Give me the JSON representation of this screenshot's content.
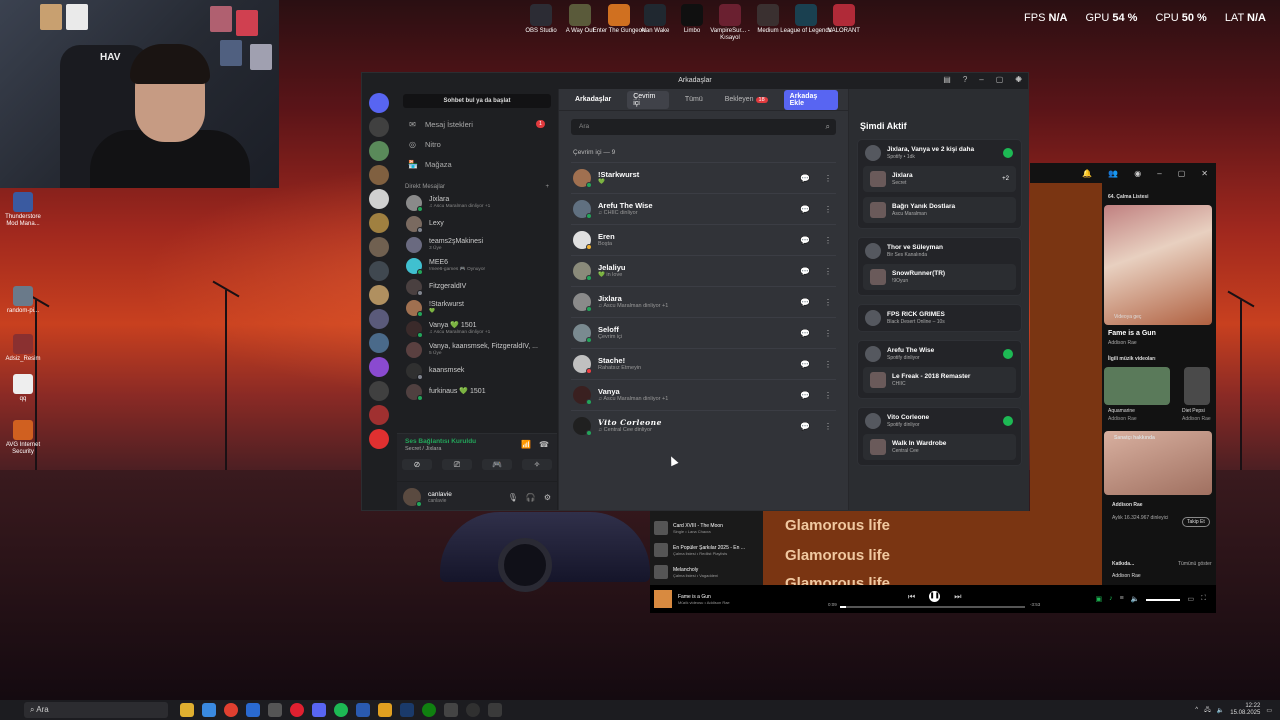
{
  "overlay": {
    "fps_label": "FPS",
    "fps_value": "N/A",
    "gpu_label": "GPU",
    "gpu_value": "54 %",
    "cpu_label": "CPU",
    "cpu_value": "50 %",
    "lat_label": "LAT",
    "lat_value": "N/A"
  },
  "desktop_icons_top": [
    {
      "label": "OBS Studio",
      "color": "#2c2c34"
    },
    {
      "label": "A Way Out",
      "color": "#5a5a3a"
    },
    {
      "label": "Enter The Gungeon",
      "color": "#d07020"
    },
    {
      "label": "Alan Wake",
      "color": "#202830"
    },
    {
      "label": "Limbo",
      "color": "#101010"
    },
    {
      "label": "VampireSur... - Kısayol",
      "color": "#6a2030"
    },
    {
      "label": "Medium",
      "color": "#3a3030"
    },
    {
      "label": "League of Legends",
      "color": "#1a4050"
    },
    {
      "label": "VALORANT",
      "color": "#b02a38"
    }
  ],
  "desktop_icons_left": [
    {
      "label": "Thunderstore Mod Mana...",
      "color": "#3a5aa0"
    },
    {
      "label": "random-pi...",
      "color": "#6a7a8a"
    },
    {
      "label": "Adsiz_Resim",
      "color": "#8a3030"
    },
    {
      "label": "qq",
      "color": "#eeeeee"
    },
    {
      "label": "AVG Internet Security",
      "color": "#d06020"
    }
  ],
  "discord": {
    "window_title": "Arkadaşlar",
    "find_conversation": "Sohbet bul ya da başlat",
    "nav": [
      {
        "label": "Arkadaşlar",
        "badge": "18",
        "icon": "friends-icon"
      },
      {
        "label": "Mesaj İstekleri",
        "badge": "1",
        "icon": "mail-icon"
      },
      {
        "label": "Nitro",
        "badge": "",
        "icon": "nitro-icon"
      },
      {
        "label": "Mağaza",
        "badge": "",
        "icon": "shop-icon"
      }
    ],
    "dm_header": "Direkt Mesajlar",
    "dm_add": "+",
    "dms": [
      {
        "name": "Jixlara",
        "sub": "♫ Ascu Maralman dinliyor +1",
        "color": "#8a8a8a",
        "status": "#23a55a"
      },
      {
        "name": "Lexy",
        "sub": "",
        "color": "#7a6a60",
        "status": "#80848e"
      },
      {
        "name": "teams2şMakinesi",
        "sub": "3 Üye",
        "color": "#6a6a80",
        "status": ""
      },
      {
        "name": "MEE6",
        "sub": "!mee6-games 🎮 Oynuyor",
        "color": "#40c0d0",
        "status": "#23a55a"
      },
      {
        "name": "FitzgeraldIV",
        "sub": "",
        "color": "#4a4040",
        "status": "#80848e"
      },
      {
        "name": "!Starkwurst",
        "sub": "💚",
        "color": "#a07050",
        "status": "#23a55a"
      },
      {
        "name": "Vanya  💚 1501",
        "sub": "♫ Ascu Maralman dinliyor +1",
        "color": "#3a2a2a",
        "status": "#23a55a"
      },
      {
        "name": "Vanya, kaansmsek, FitzgeraldIV, ...",
        "sub": "5 Üye",
        "color": "#5a4040",
        "status": ""
      },
      {
        "name": "kaansmsek",
        "sub": "",
        "color": "#303030",
        "status": "#80848e"
      },
      {
        "name": "furkinaus 💚 1501",
        "sub": "",
        "color": "#504040",
        "status": "#23a55a"
      }
    ],
    "voice": {
      "status": "Ses Bağlantısı Kuruldu",
      "channel": "Secret / Jixlara"
    },
    "user": {
      "name": "canlavie",
      "status": "canlavie"
    },
    "tabs": {
      "title": "Arkadaşlar",
      "online": "Çevrim içi",
      "all": "Tümü",
      "pending": "Bekleyen",
      "pending_count": "18",
      "add_friend": "Arkadaş Ekle"
    },
    "search_placeholder": "Ara",
    "online_count_label": "Çevrim içi — 9",
    "friends": [
      {
        "name": "!Starkwurst",
        "sub": "💚",
        "color": "#a07050",
        "status": "#23a55a"
      },
      {
        "name": "Arefu The Wise",
        "sub": "♫ CHIIC dinliyor",
        "color": "#607080",
        "status": "#23a55a"
      },
      {
        "name": "Eren",
        "sub": "Boşta",
        "color": "#e0e0e0",
        "status": "#f0b232"
      },
      {
        "name": "Jelaliyu",
        "sub": "💚 in love",
        "color": "#8a8a7a",
        "status": "#23a55a"
      },
      {
        "name": "Jixlara",
        "sub": "♫ Ascu Maralman dinliyor +1",
        "color": "#8a8a8a",
        "status": "#23a55a"
      },
      {
        "name": "Seloff",
        "sub": "Çevrim içi",
        "color": "#7a8a90",
        "status": "#23a55a"
      },
      {
        "name": "Stache!",
        "sub": "Rahatsız Etmeyin",
        "color": "#c0c0c0",
        "status": "#f23f43"
      },
      {
        "name": "Vanya",
        "sub": "♫ Ascu Maralman dinliyor +1",
        "color": "#3a2020",
        "status": "#23a55a"
      },
      {
        "name": "Vito Corleone",
        "sub": "♫ Central Cee dinliyor",
        "color": "#202020",
        "status": "#23a55a"
      }
    ],
    "active_now": {
      "title": "Şimdi Aktif",
      "cards": [
        {
          "name": "Jixlara, Vanya ve 2 kişi daha",
          "sub": "Spotify • 1dk",
          "spotify": true,
          "items": [
            {
              "name": "Jixlara",
              "sub": "Secret",
              "extra": "+2"
            },
            {
              "name": "Bağrı Yanık Dostlara",
              "sub": "Ascu Maralman",
              "extra": ""
            }
          ]
        },
        {
          "name": "Thor ve Süleyman",
          "sub": "Bir Ses Kanalında",
          "spotify": false,
          "items": [
            {
              "name": "SnowRunner(TR)",
              "sub": "!9Oyun",
              "extra": ""
            }
          ]
        },
        {
          "name": "FPS RICK GRIMES",
          "sub": "Black Desert Online – 10s",
          "spotify": false,
          "items": []
        },
        {
          "name": "Arefu The Wise",
          "sub": "Spotify dinliyor",
          "spotify": true,
          "items": [
            {
              "name": "Le Freak - 2018 Remaster",
              "sub": "CHIIC",
              "extra": ""
            }
          ]
        },
        {
          "name": "Vito Corleone",
          "sub": "Spotify dinliyor",
          "spotify": true,
          "items": [
            {
              "name": "Walk In Wardrobe",
              "sub": "Central Cee",
              "extra": ""
            }
          ]
        }
      ]
    }
  },
  "spotify": {
    "now_playing_list": "64. Çalma Listesi",
    "video_label": "Videoya geç",
    "track": "Fame is a Gun",
    "artist": "Addison Rae",
    "related_header": "İlgili müzik videoları",
    "related": [
      {
        "title": "Aquamarine",
        "artist": "Addison Rae"
      },
      {
        "title": "Diet Pepsi",
        "artist": "Addison Rae"
      }
    ],
    "about": "Sanatçı hakkında",
    "artist_name": "Addison Rae",
    "listeners": "Aylık 16.324.967 dinleyici",
    "follow": "Takip Et",
    "credits": "Katkıda...",
    "show_all": "Tümünü göster",
    "lyrics": [
      "Glamorous life",
      "Glamorous life",
      "Glamorous life"
    ],
    "queue": [
      {
        "title": "Card XVIII - The Moon",
        "sub": "Single • Lana Chacra"
      },
      {
        "title": "En Popüler Şarkılar 2025 - En ...",
        "sub": "Çalma listesi • Redlist Playlists"
      },
      {
        "title": "Melancholy",
        "sub": "Çalma listesi • Vagaddeni"
      }
    ],
    "player": {
      "title": "Fame is a Gun",
      "sub": "Müzik videosu • Addison Rae",
      "elapsed": "0:09",
      "remaining": "-3:53",
      "progress": 0.03
    }
  },
  "taskbar": {
    "search": "Ara",
    "time": "12:22",
    "date": "15.08.2025"
  }
}
